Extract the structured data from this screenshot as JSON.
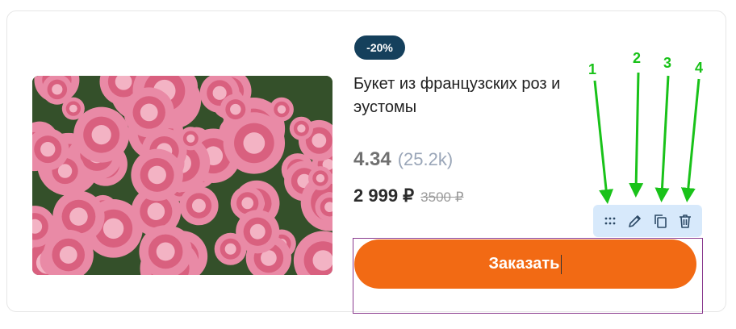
{
  "product": {
    "discount_badge": "-20%",
    "title": "Букет из французских роз и эустомы",
    "rating": "4.34",
    "rating_count": "(25.2k)",
    "price": "2 999 ₽",
    "old_price": "3500 ₽",
    "order_button_label": "Заказать"
  },
  "annotations": {
    "labels": [
      "1",
      "2",
      "3",
      "4"
    ],
    "color": "#19c219"
  },
  "toolbar": {
    "icons": [
      "drag-handle-icon",
      "pencil-icon",
      "copy-icon",
      "trash-icon"
    ],
    "background": "#d7e9fb"
  },
  "colors": {
    "accent": "#f26a14",
    "badge": "#15405c"
  }
}
